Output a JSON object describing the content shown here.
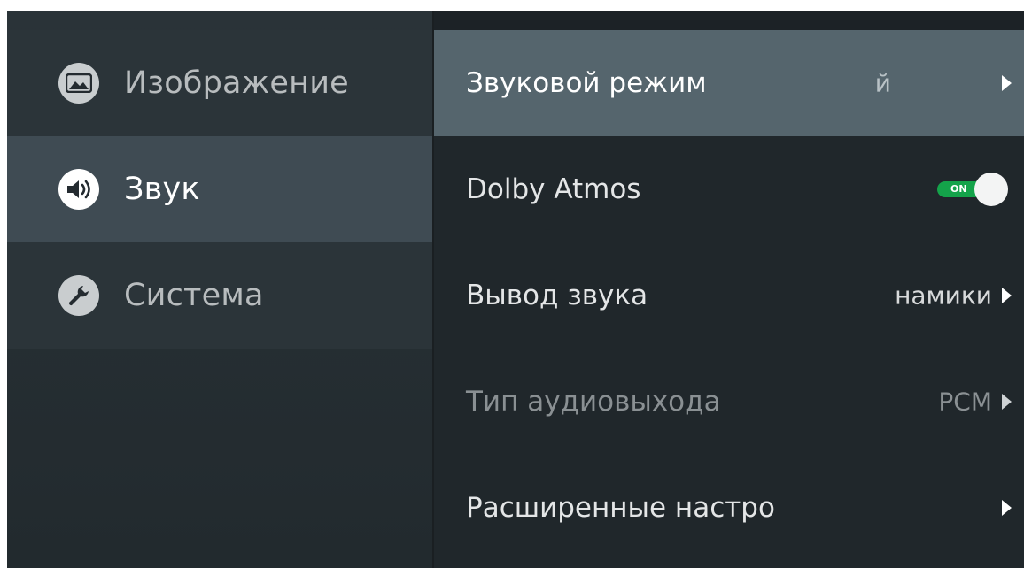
{
  "sidebar": {
    "items": [
      {
        "label": "Изображение",
        "icon": "image-icon",
        "selected": false
      },
      {
        "label": "Звук",
        "icon": "speaker-icon",
        "selected": true
      },
      {
        "label": "Система",
        "icon": "wrench-icon",
        "selected": false
      }
    ]
  },
  "options": [
    {
      "label": "Звуковой режим",
      "value": "й",
      "focused": true
    },
    {
      "label": "Dolby Atmos",
      "toggle": {
        "state": "ON",
        "on": true
      }
    },
    {
      "label": "Вывод звука",
      "value": "намики"
    },
    {
      "label": "Тип аудиовыхода",
      "value": "PCM",
      "dimmed": true
    },
    {
      "label": "Расширенные настро",
      "value": ""
    }
  ],
  "colors": {
    "background": "#242b30",
    "sidebar_selected": "#3f4b53",
    "option_focused": "#55656d",
    "toggle_on": "#14a34a"
  }
}
